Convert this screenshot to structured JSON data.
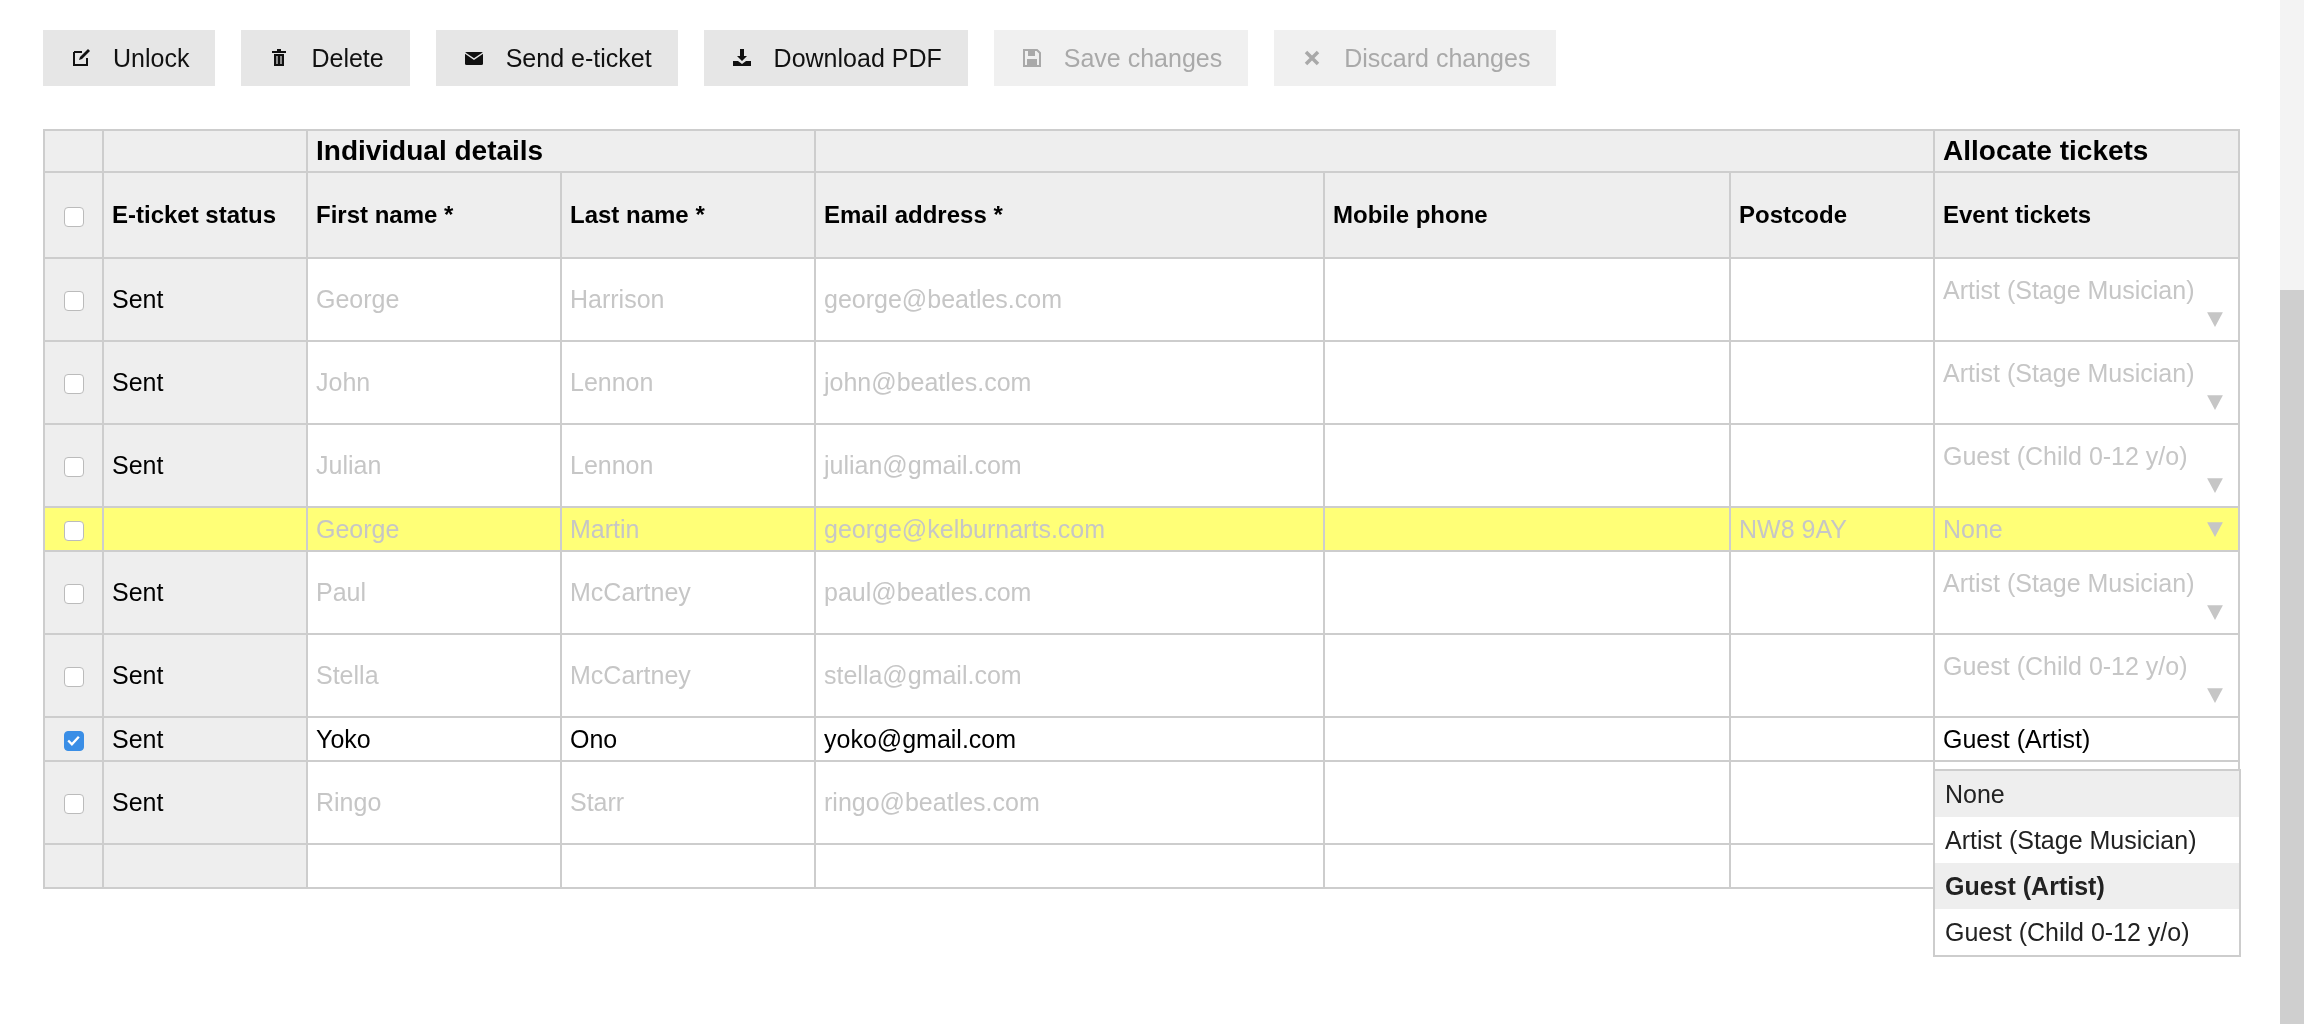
{
  "toolbar": {
    "buttons": [
      {
        "label": "Unlock",
        "disabled": false
      },
      {
        "label": "Delete",
        "disabled": false
      },
      {
        "label": "Send e-ticket",
        "disabled": false
      },
      {
        "label": "Download PDF",
        "disabled": false
      },
      {
        "label": "Save changes",
        "disabled": true
      },
      {
        "label": "Discard changes",
        "disabled": true
      }
    ]
  },
  "table": {
    "group_headers": [
      "Individual details",
      "Allocate tickets"
    ],
    "select_all": {
      "checked": false
    },
    "columns": [
      "E-ticket status",
      "First name *",
      "Last name *",
      "Email address *",
      "Mobile phone",
      "Postcode",
      "Event tickets"
    ],
    "rows": [
      {
        "checked": false,
        "locked": true,
        "highlighted": false,
        "status": "Sent",
        "first_name": "George",
        "last_name": "Harrison",
        "email": "george@beatles.com",
        "ticket": {
          "value": "Artist (Stage Musician)",
          "open": false
        }
      },
      {
        "checked": false,
        "locked": true,
        "highlighted": false,
        "status": "Sent",
        "first_name": "John",
        "last_name": "Lennon",
        "email": "john@beatles.com",
        "ticket": {
          "value": "Artist (Stage Musician)",
          "open": false
        }
      },
      {
        "checked": false,
        "locked": true,
        "highlighted": false,
        "status": "Sent",
        "first_name": "Julian",
        "last_name": "Lennon",
        "email": "julian@gmail.com",
        "ticket": {
          "value": "Guest (Child 0-12 y/o)",
          "open": false
        }
      },
      {
        "checked": false,
        "locked": true,
        "highlighted": true,
        "first_name": "George",
        "last_name": "Martin",
        "email": "george@kelburnarts.com",
        "postcode": "NW8 9AY",
        "ticket": {
          "value": "None",
          "open": false
        }
      },
      {
        "checked": false,
        "locked": true,
        "highlighted": false,
        "status": "Sent",
        "first_name": "Paul",
        "last_name": "McCartney",
        "email": "paul@beatles.com",
        "ticket": {
          "value": "Artist (Stage Musician)",
          "open": false
        }
      },
      {
        "checked": false,
        "locked": true,
        "highlighted": false,
        "status": "Sent",
        "first_name": "Stella",
        "last_name": "McCartney",
        "email": "stella@gmail.com",
        "ticket": {
          "value": "Guest (Child 0-12 y/o)",
          "open": false
        }
      },
      {
        "checked": true,
        "locked": false,
        "highlighted": false,
        "status": "Sent",
        "first_name": "Yoko",
        "last_name": "Ono",
        "email": "yoko@gmail.com",
        "ticket": {
          "value": "Guest  (Artist)",
          "open": true,
          "options": [
            {
              "label": "None",
              "selected": false,
              "hovered": true
            },
            {
              "label": "Artist (Stage Musician)",
              "selected": false,
              "hovered": false
            },
            {
              "label": "Guest (Artist)",
              "selected": true,
              "hovered": false
            },
            {
              "label": "Guest (Child 0-12 y/o)",
              "selected": false,
              "hovered": false
            }
          ]
        }
      },
      {
        "checked": false,
        "locked": true,
        "highlighted": false,
        "status": "Sent",
        "first_name": "Ringo",
        "last_name": "Starr",
        "email": "ringo@beatles.com"
      }
    ]
  }
}
